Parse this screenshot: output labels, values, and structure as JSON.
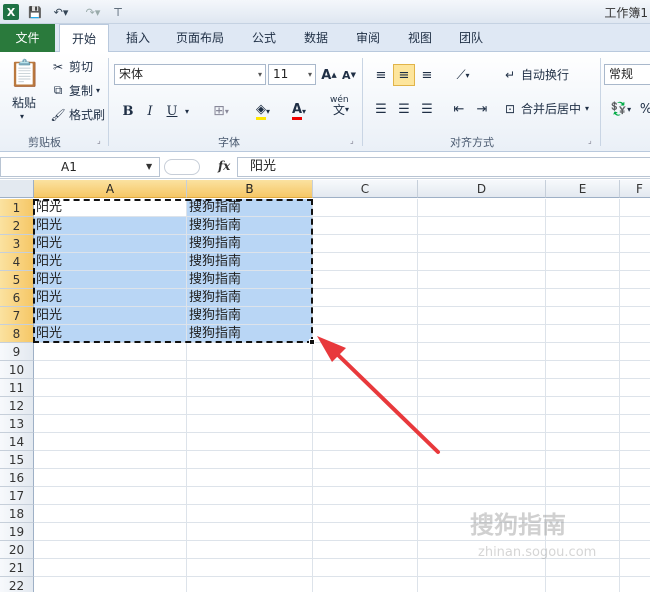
{
  "titlebar": {
    "title": "工作簿1",
    "logo": "X"
  },
  "tabs": [
    "文件",
    "开始",
    "插入",
    "页面布局",
    "公式",
    "数据",
    "审阅",
    "视图",
    "团队"
  ],
  "ribbon": {
    "clipboard": {
      "paste": "粘贴",
      "cut": "剪切",
      "copy": "复制",
      "format_painter": "格式刷",
      "group": "剪贴板"
    },
    "font": {
      "name": "宋体",
      "size": "11",
      "bold": "B",
      "italic": "I",
      "underline": "U",
      "group": "字体",
      "wen": "wén"
    },
    "alignment": {
      "wrap": "自动换行",
      "merge": "合并后居中",
      "group": "对齐方式"
    },
    "number": {
      "format": "常规"
    }
  },
  "formula_bar": {
    "name_box": "A1",
    "fx": "fx",
    "value": "阳光"
  },
  "grid": {
    "columns": [
      "A",
      "B",
      "C",
      "D",
      "E",
      "F"
    ],
    "rows": [
      "1",
      "2",
      "3",
      "4",
      "5",
      "6",
      "7",
      "8",
      "9",
      "10",
      "11",
      "12",
      "13",
      "14",
      "15",
      "16",
      "17",
      "18",
      "19",
      "20",
      "21",
      "22"
    ],
    "data": [
      [
        "阳光",
        "搜狗指南"
      ],
      [
        "阳光",
        "搜狗指南"
      ],
      [
        "阳光",
        "搜狗指南"
      ],
      [
        "阳光",
        "搜狗指南"
      ],
      [
        "阳光",
        "搜狗指南"
      ],
      [
        "阳光",
        "搜狗指南"
      ],
      [
        "阳光",
        "搜狗指南"
      ],
      [
        "阳光",
        "搜狗指南"
      ]
    ]
  },
  "watermark": {
    "text": "搜狗指南",
    "url": "zhinan.sogou.com"
  },
  "colors": {
    "accent": "#2a7a3c",
    "selection": "#b9d6f5",
    "arrow": "#e8393c"
  }
}
